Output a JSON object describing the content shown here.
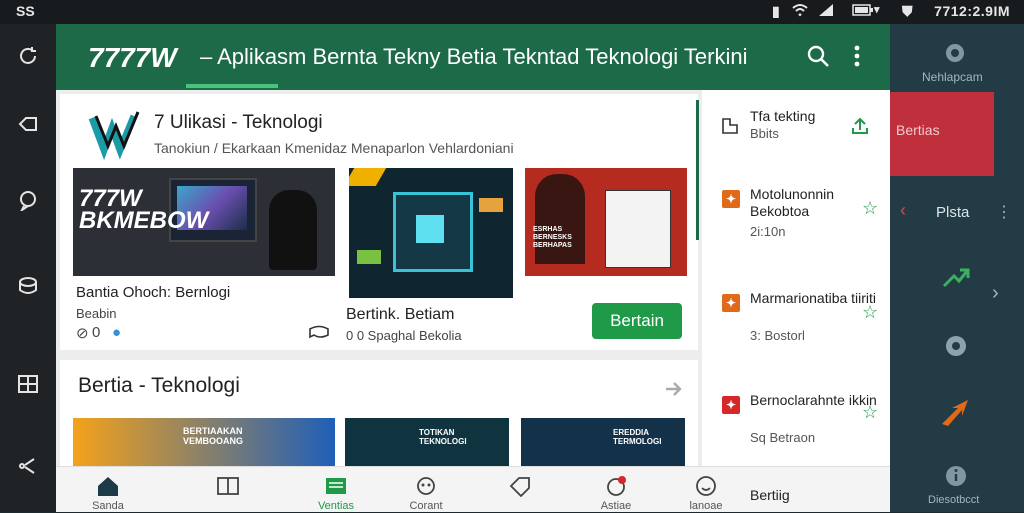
{
  "status_bar": {
    "left_text": "SS",
    "time_text": "7712:2.9IM",
    "icons": [
      "vibrate-icon",
      "wifi-icon",
      "signal-icon",
      "battery-icon",
      "dropdown-icon"
    ]
  },
  "left_rail": {
    "icons": [
      "refresh-icon",
      "back-icon",
      "chat-icon",
      "storage-icon",
      "grid-icon",
      "share-icon"
    ]
  },
  "header": {
    "logo": "7777W",
    "title": "– Aplikasm Bernta Tekny Betia Tekntad Teknologi Terkini",
    "accent_color": "#1c6a48",
    "icons": [
      "search-icon",
      "more-vert-icon"
    ]
  },
  "app_card": {
    "app_name": "7 Ulikasi - Teknologi",
    "subtitle": "Tanokiun / Ekarkaan Kmenidaz Menaparlon Vehlardoniani"
  },
  "thumbnails": [
    {
      "overlay_text": "777W\nBKMEBOW",
      "theme": "person-at-computer"
    },
    {
      "overlay_text": "",
      "theme": "circuit-chip"
    },
    {
      "overlay_text": "ESRHAS\nBERNESKS\nBERHAPAS",
      "theme": "heroes-poster"
    }
  ],
  "item1": {
    "caption": "Bantia Ohoch: Bernlogi",
    "author": "Beabin",
    "count": "0",
    "icons": [
      "like-icon",
      "comment-icon"
    ]
  },
  "item2": {
    "caption": "Bertink. Betiam",
    "meta": "0 0 Spaghal Bekolia"
  },
  "action_button": "Bertain",
  "section2": {
    "title": "Bertia - Teknologi",
    "thumbs": [
      {
        "overlay_text": "BERTIAAKAN\nVEMBOOANG"
      },
      {
        "overlay_text": "TOTIKAN\nTEKNOLOGI"
      },
      {
        "overlay_text": "EREDDIA\nTERMOLOGI"
      }
    ]
  },
  "right_list": [
    {
      "title": "Tfa tekting",
      "subtitle": "Bbits",
      "badge_color": "",
      "icon": "share-icon"
    },
    {
      "title": "Motolunonnin Bekobtoa",
      "subtitle": "2i:10n",
      "badge_color": "#e06a1a",
      "icon": "star-icon"
    },
    {
      "title": "Marmarionatiba tiiriti",
      "subtitle": "3: Bostorl",
      "badge_color": "#e06a1a",
      "icon": "star-icon"
    },
    {
      "title": "Bernoclarahnte ikkin",
      "subtitle": "Sq Betraon",
      "badge_color": "#d62828",
      "icon": "star-icon"
    }
  ],
  "bottom_nav": [
    {
      "label": "Sanda",
      "icon": "home-icon"
    },
    {
      "label": "",
      "icon": "book-icon"
    },
    {
      "label": "Ventias",
      "icon": "news-icon"
    },
    {
      "label": "Corant",
      "icon": "bot-icon"
    },
    {
      "label": "",
      "icon": "tag-icon"
    },
    {
      "label": "Astiae",
      "icon": "notification-icon"
    },
    {
      "label": "lanoae",
      "icon": "smile-icon"
    },
    {
      "label": "Bertiig",
      "icon": "text-icon"
    }
  ],
  "right_panel": {
    "settings_label": "Nehlapcam",
    "red_tab_label": "Bertias",
    "menu_label": "Plsta",
    "info_label": "Diesotbcct",
    "icons": [
      "settings-icon",
      "back-arrow-icon",
      "more-vert-icon",
      "trend-arrow-icon",
      "chevron-right-icon",
      "gear-icon",
      "arrow-orange-icon",
      "info-icon"
    ]
  }
}
